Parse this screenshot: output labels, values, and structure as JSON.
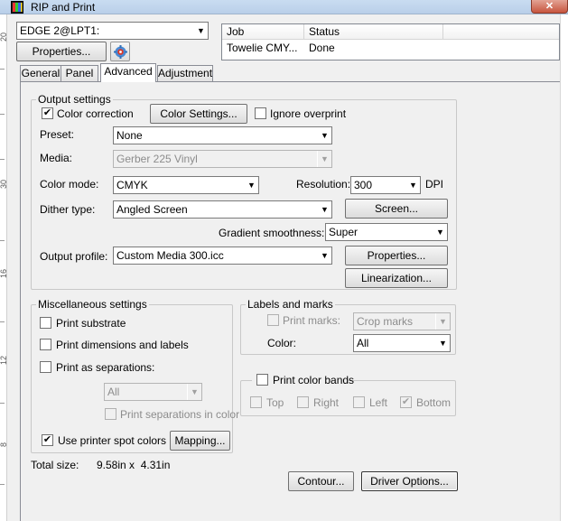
{
  "window": {
    "title": "RIP and Print",
    "close_glyph": "✕"
  },
  "ruler": {
    "numbers": [
      "20",
      "30",
      "16",
      "12",
      "8"
    ]
  },
  "printer": {
    "selected": "EDGE 2@LPT1:"
  },
  "toolbar": {
    "properties_label": "Properties..."
  },
  "job_list": {
    "columns": [
      "Job",
      "Status"
    ],
    "rows": [
      {
        "job": "Towelie CMY...",
        "status": "Done"
      }
    ]
  },
  "tabs": [
    {
      "label": "General"
    },
    {
      "label": "Panel"
    },
    {
      "label": "Advanced",
      "active": true
    },
    {
      "label": "Adjustment"
    }
  ],
  "output_settings": {
    "title": "Output settings",
    "color_correction": {
      "label": "Color correction",
      "checked": true
    },
    "color_settings_button": "Color Settings...",
    "ignore_overprint": {
      "label": "Ignore overprint",
      "checked": false
    },
    "preset": {
      "label": "Preset:",
      "value": "None"
    },
    "media": {
      "label": "Media:",
      "value": "Gerber 225 Vinyl"
    },
    "color_mode": {
      "label": "Color mode:",
      "value": "CMYK"
    },
    "resolution": {
      "label": "Resolution:",
      "value": "300",
      "unit": "DPI"
    },
    "dither_type": {
      "label": "Dither type:",
      "value": "Angled Screen"
    },
    "screen_button": "Screen...",
    "gradient_smoothness": {
      "label": "Gradient smoothness:",
      "value": "Super"
    },
    "output_profile": {
      "label": "Output profile:",
      "value": "Custom Media 300.icc"
    },
    "properties_button": "Properties...",
    "linearization_button": "Linearization..."
  },
  "misc_settings": {
    "title": "Miscellaneous settings",
    "print_substrate": {
      "label": "Print substrate",
      "checked": false
    },
    "print_dimensions": {
      "label": "Print dimensions and labels",
      "checked": false
    },
    "print_as_separations": {
      "label": "Print as separations:",
      "checked": false
    },
    "separations_select": {
      "value": "All"
    },
    "print_separations_in_color": {
      "label": "Print separations in color",
      "checked": false
    },
    "use_printer_spot_colors": {
      "label": "Use printer spot colors",
      "checked": true
    },
    "mapping_button": "Mapping..."
  },
  "labels_marks": {
    "title": "Labels and marks",
    "print_marks": {
      "label": "Print marks:",
      "checked": false
    },
    "marks_select": {
      "value": "Crop marks"
    },
    "color": {
      "label": "Color:",
      "value": "All"
    }
  },
  "color_bands": {
    "title": "Print color bands",
    "checked": false,
    "top": {
      "label": "Top",
      "checked": false
    },
    "right": {
      "label": "Right",
      "checked": false
    },
    "left": {
      "label": "Left",
      "checked": false
    },
    "bottom": {
      "label": "Bottom",
      "checked": true
    }
  },
  "total_size": {
    "label": "Total size:",
    "value": "9.58in x  4.31in"
  },
  "footer": {
    "contour_button": "Contour...",
    "driver_options_button": "Driver Options..."
  },
  "check_glyph": "✔",
  "arrow_glyph": "▼"
}
